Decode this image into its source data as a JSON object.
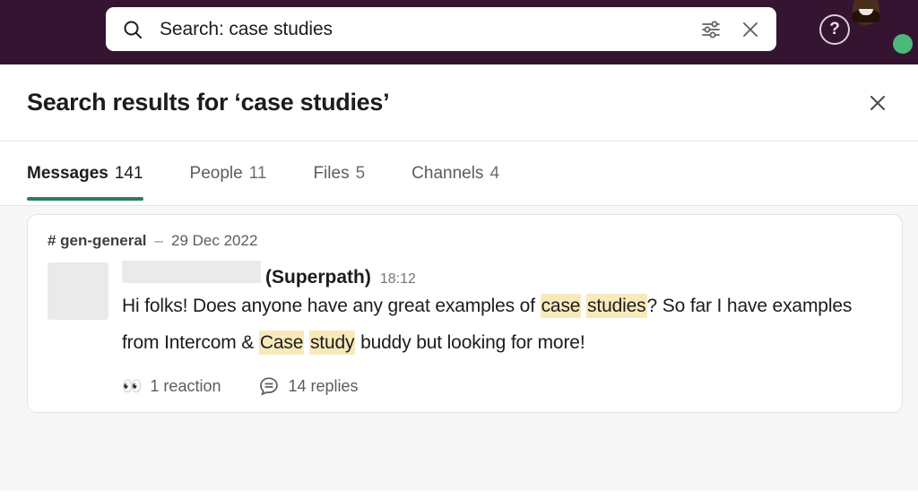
{
  "topbar": {
    "search": {
      "icon": "search-icon",
      "value": "Search: case studies",
      "placeholder": "Search"
    },
    "filter_icon": "sliders-filter-icon",
    "clear_icon": "close-icon",
    "help_icon": "?",
    "avatar": {
      "name": "user-avatar",
      "presence": "online"
    },
    "background_color": "#341431"
  },
  "results_header": {
    "title": "Search results for ‘case studies’",
    "close_icon": "close-icon"
  },
  "tabs": [
    {
      "label": "Messages",
      "count": "141",
      "active": true
    },
    {
      "label": "People",
      "count": "11",
      "active": false
    },
    {
      "label": "Files",
      "count": "5",
      "active": false
    },
    {
      "label": "Channels",
      "count": "4",
      "active": false
    }
  ],
  "tab_accent_color": "#2d7d5a",
  "results": [
    {
      "channel": "# gen-general",
      "separator": "–",
      "date": "29 Dec 2022",
      "author_org": "(Superpath)",
      "time": "18:12",
      "message_segments": [
        {
          "text": "Hi folks! Does anyone have any great examples of ",
          "highlight": false
        },
        {
          "text": "case",
          "highlight": true
        },
        {
          "text": " ",
          "highlight": false
        },
        {
          "text": "studies",
          "highlight": true
        },
        {
          "text": "? So far I have examples from Intercom & ",
          "highlight": false
        },
        {
          "text": "Case",
          "highlight": true
        },
        {
          "text": " ",
          "highlight": false
        },
        {
          "text": "study",
          "highlight": true
        },
        {
          "text": " buddy but looking for more!",
          "highlight": false
        }
      ],
      "reactions": {
        "emoji": "👀",
        "label": "1 reaction"
      },
      "replies": {
        "icon": "thread-comment-icon",
        "label": "14 replies"
      }
    }
  ],
  "highlight_color": "#f8e9bb"
}
